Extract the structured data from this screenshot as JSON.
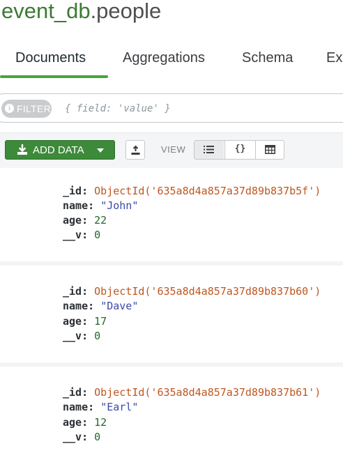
{
  "header": {
    "db_name": "event_db",
    "collection_name": ".people"
  },
  "tabs": [
    {
      "label": "Documents",
      "active": true
    },
    {
      "label": "Aggregations",
      "active": false
    },
    {
      "label": "Schema",
      "active": false
    },
    {
      "label": "Ex",
      "active": false
    }
  ],
  "filter": {
    "pill_label": "FILTER",
    "placeholder": "{ field: 'value' }"
  },
  "toolbar": {
    "add_data_label": "ADD DATA",
    "view_label": "VIEW",
    "view_modes": [
      "list-icon",
      "json-braces",
      "table-icon"
    ],
    "json_braces": "{}"
  },
  "documents": [
    {
      "keys": {
        "id": "_id:",
        "name": "name:",
        "age": "age:",
        "v": "__v:"
      },
      "id": "ObjectId('635a8d4a857a37d89b837b5f')",
      "name": "\"John\"",
      "age": "22",
      "v": "0"
    },
    {
      "keys": {
        "id": "_id:",
        "name": "name:",
        "age": "age:",
        "v": "__v:"
      },
      "id": "ObjectId('635a8d4a857a37d89b837b60')",
      "name": "\"Dave\"",
      "age": "17",
      "v": "0"
    },
    {
      "keys": {
        "id": "_id:",
        "name": "name:",
        "age": "age:",
        "v": "__v:"
      },
      "id": "ObjectId('635a8d4a857a37d89b837b61')",
      "name": "\"Earl\"",
      "age": "12",
      "v": "0"
    }
  ],
  "colors": {
    "brand_green": "#3d8a3a",
    "tab_underline": "#45a53e",
    "objectid": "#c0561f",
    "string": "#3c4aa8",
    "number": "#1e6a2c"
  }
}
